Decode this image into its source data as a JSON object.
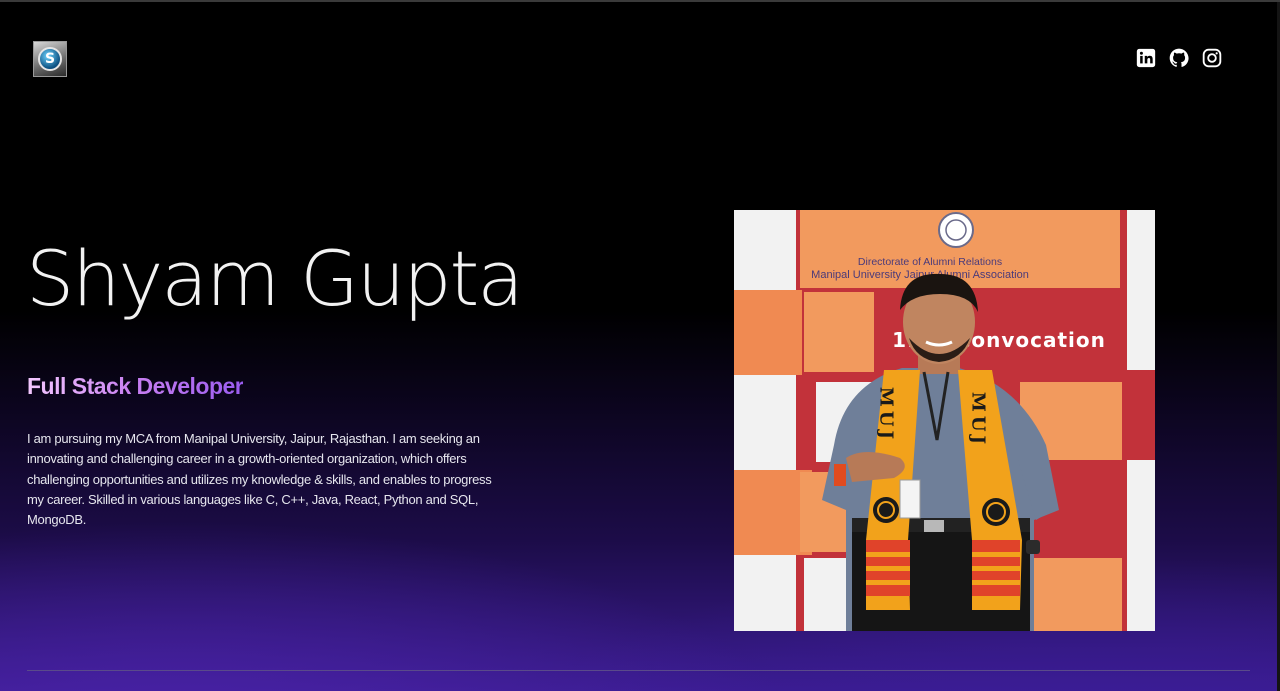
{
  "header": {
    "logo_text": "S",
    "social": [
      {
        "name": "linkedin"
      },
      {
        "name": "github"
      },
      {
        "name": "instagram"
      }
    ]
  },
  "hero": {
    "name": "Shyam Gupta",
    "role": "Full Stack Developer",
    "bio": "I am pursuing my MCA from Manipal University, Jaipur, Rajasthan. I am seeking an innovating and challenging career in a growth-oriented organization, which offers challenging opportunities and utilizes my knowledge & skills, and enables to progress my career. Skilled in various languages like C, C++, Java, React, Python and SQL, MongoDB."
  },
  "photo": {
    "backdrop_top_line1": "Directorate of Alumni Relations",
    "backdrop_top_line2": "Manipal University Jaipur Alumni Association",
    "backdrop_banner": "11th Convocation",
    "stole_left": "MUJ",
    "stole_right": "MUJ"
  },
  "colors": {
    "accent_gradient_start": "#f4c8ff",
    "accent_gradient_end": "#9a5cf0",
    "background_bottom": "#3a1c8f"
  }
}
